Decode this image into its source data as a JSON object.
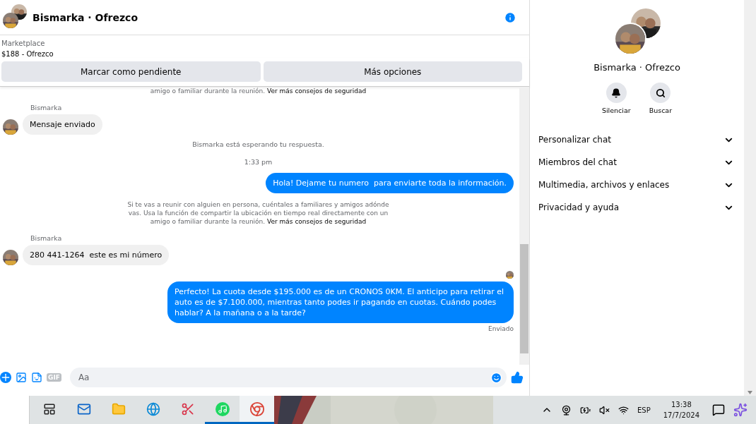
{
  "header": {
    "title": "Bismarka · Ofrezco"
  },
  "listing": {
    "source": "Marketplace",
    "item": "$188 - Ofrezco"
  },
  "actions": [
    "Marcar como pendiente",
    "Más opciones"
  ],
  "messages": [
    {
      "kind": "notice",
      "text": "amigo o familiar durante la reunión.",
      "link": "Ver más consejos de seguridad"
    },
    {
      "kind": "incoming",
      "sender": "Bismarka",
      "text": "Mensaje enviado"
    },
    {
      "kind": "status",
      "text": "Bismarka está esperando tu respuesta."
    },
    {
      "kind": "time",
      "text": "1:33 pm"
    },
    {
      "kind": "outgoing",
      "text": "Hola! Dejame tu numero  para enviarte toda la información."
    },
    {
      "kind": "notice",
      "text": "Si te vas a reunir con alguien en persona, cuéntales a familiares y amigos adónde vas. Usa la función de compartir la ubicación en tiempo real directamente con un amigo o familiar durante la reunión.",
      "link": "Ver más consejos de seguridad"
    },
    {
      "kind": "incoming",
      "sender": "Bismarka",
      "text": "280 441-1264  este es mi número"
    },
    {
      "kind": "outgoing",
      "text": "Perfecto! La cuota desde $195.000 es de un CRONOS 0KM. El anticipo para retirar el auto es de $7.100.000, mientras tanto podes ir pagando en cuotas. Cuándo podes hablar? A la mañana o a la tarde?",
      "seen": true,
      "status": "Enviado"
    }
  ],
  "composer": {
    "gif": "GIF",
    "placeholder": "Aa"
  },
  "panel": {
    "name": "Bismarka · Ofrezco",
    "actions": [
      {
        "kind": "bell",
        "label": "Silenciar"
      },
      {
        "kind": "search",
        "label": "Buscar"
      }
    ],
    "sections": [
      {
        "label": "Personalizar chat",
        "expanded": false
      },
      {
        "label": "Miembros del chat",
        "expanded": false
      },
      {
        "label": "Multimedia, archivos y enlaces",
        "expanded": false
      },
      {
        "label": "Privacidad y ayuda",
        "expanded": false
      }
    ]
  },
  "taskbar": {
    "apps": [
      {
        "kind": "taskview",
        "running": false,
        "selected": false
      },
      {
        "kind": "mail",
        "running": false,
        "selected": false
      },
      {
        "kind": "folder",
        "running": false,
        "selected": false
      },
      {
        "kind": "edge",
        "running": false,
        "selected": false
      },
      {
        "kind": "snip",
        "running": false,
        "selected": false
      },
      {
        "kind": "spotify",
        "running": true,
        "selected": false
      },
      {
        "kind": "chrome",
        "running": true,
        "selected": true
      }
    ],
    "language": "ESP",
    "time": "13:38",
    "date": "17/7/2024"
  }
}
